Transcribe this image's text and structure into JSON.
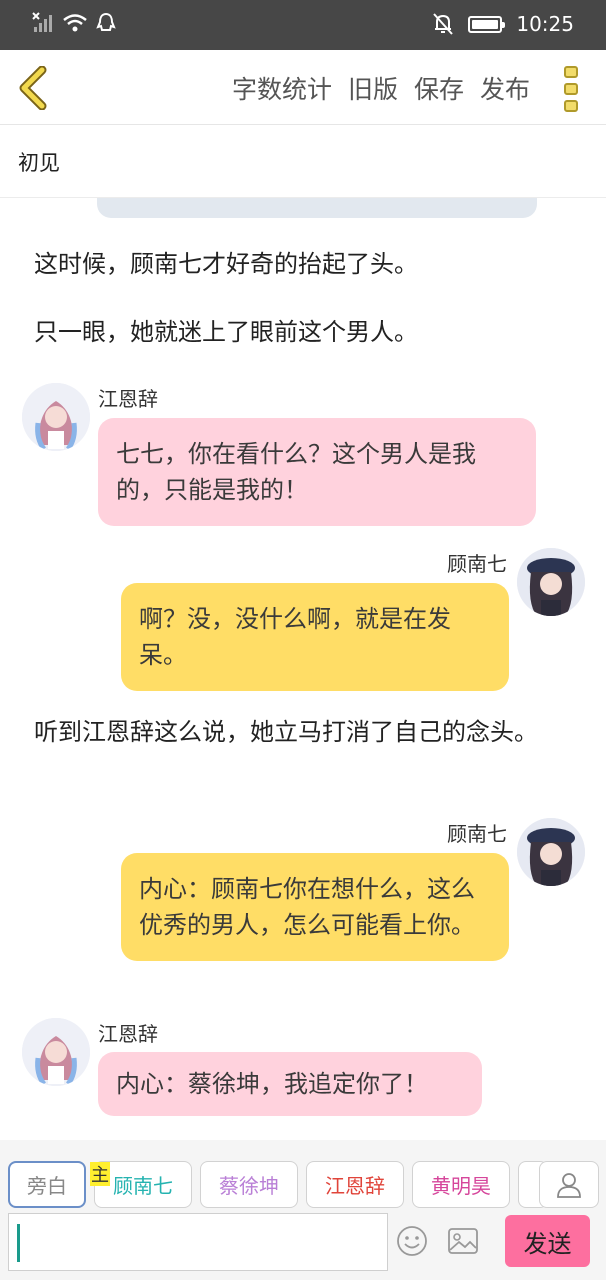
{
  "status_bar": {
    "time": "10:25"
  },
  "toolbar": {
    "actions": [
      "字数统计",
      "旧版",
      "保存",
      "发布"
    ]
  },
  "chapter": {
    "title": "初见"
  },
  "messages": [
    {
      "type": "narration",
      "text": "这时候，顾南七才好奇的抬起了头。"
    },
    {
      "type": "narration",
      "text": "只一眼，她就迷上了眼前这个男人。"
    },
    {
      "type": "left",
      "speaker": "江恩辞",
      "text": "七七，你在看什么？这个男人是我的，只能是我的！"
    },
    {
      "type": "right",
      "speaker": "顾南七",
      "text": "啊？没，没什么啊，就是在发呆。"
    },
    {
      "type": "narration",
      "text": "听到江恩辞这么说，她立马打消了自己的念头。"
    },
    {
      "type": "right",
      "speaker": "顾南七",
      "text": "内心：顾南七你在想什么，这么优秀的男人，怎么可能看上你。"
    },
    {
      "type": "left",
      "speaker": "江恩辞",
      "text": "内心：蔡徐坤，我追定你了！"
    }
  ],
  "roles": {
    "host_tag": "主",
    "items": [
      {
        "label": "旁白",
        "color": "#888888"
      },
      {
        "label": "顾南七",
        "color": "#25b3b0"
      },
      {
        "label": "蔡徐坤",
        "color": "#b97fd6"
      },
      {
        "label": "江恩辞",
        "color": "#e0443a"
      },
      {
        "label": "黄明昊",
        "color": "#d6469b"
      }
    ]
  },
  "input": {
    "value": "",
    "send_label": "发送"
  },
  "colors": {
    "pink_bubble": "#ffd2dd",
    "yellow_bubble": "#ffdd66",
    "send_button": "#fd6f9f"
  }
}
